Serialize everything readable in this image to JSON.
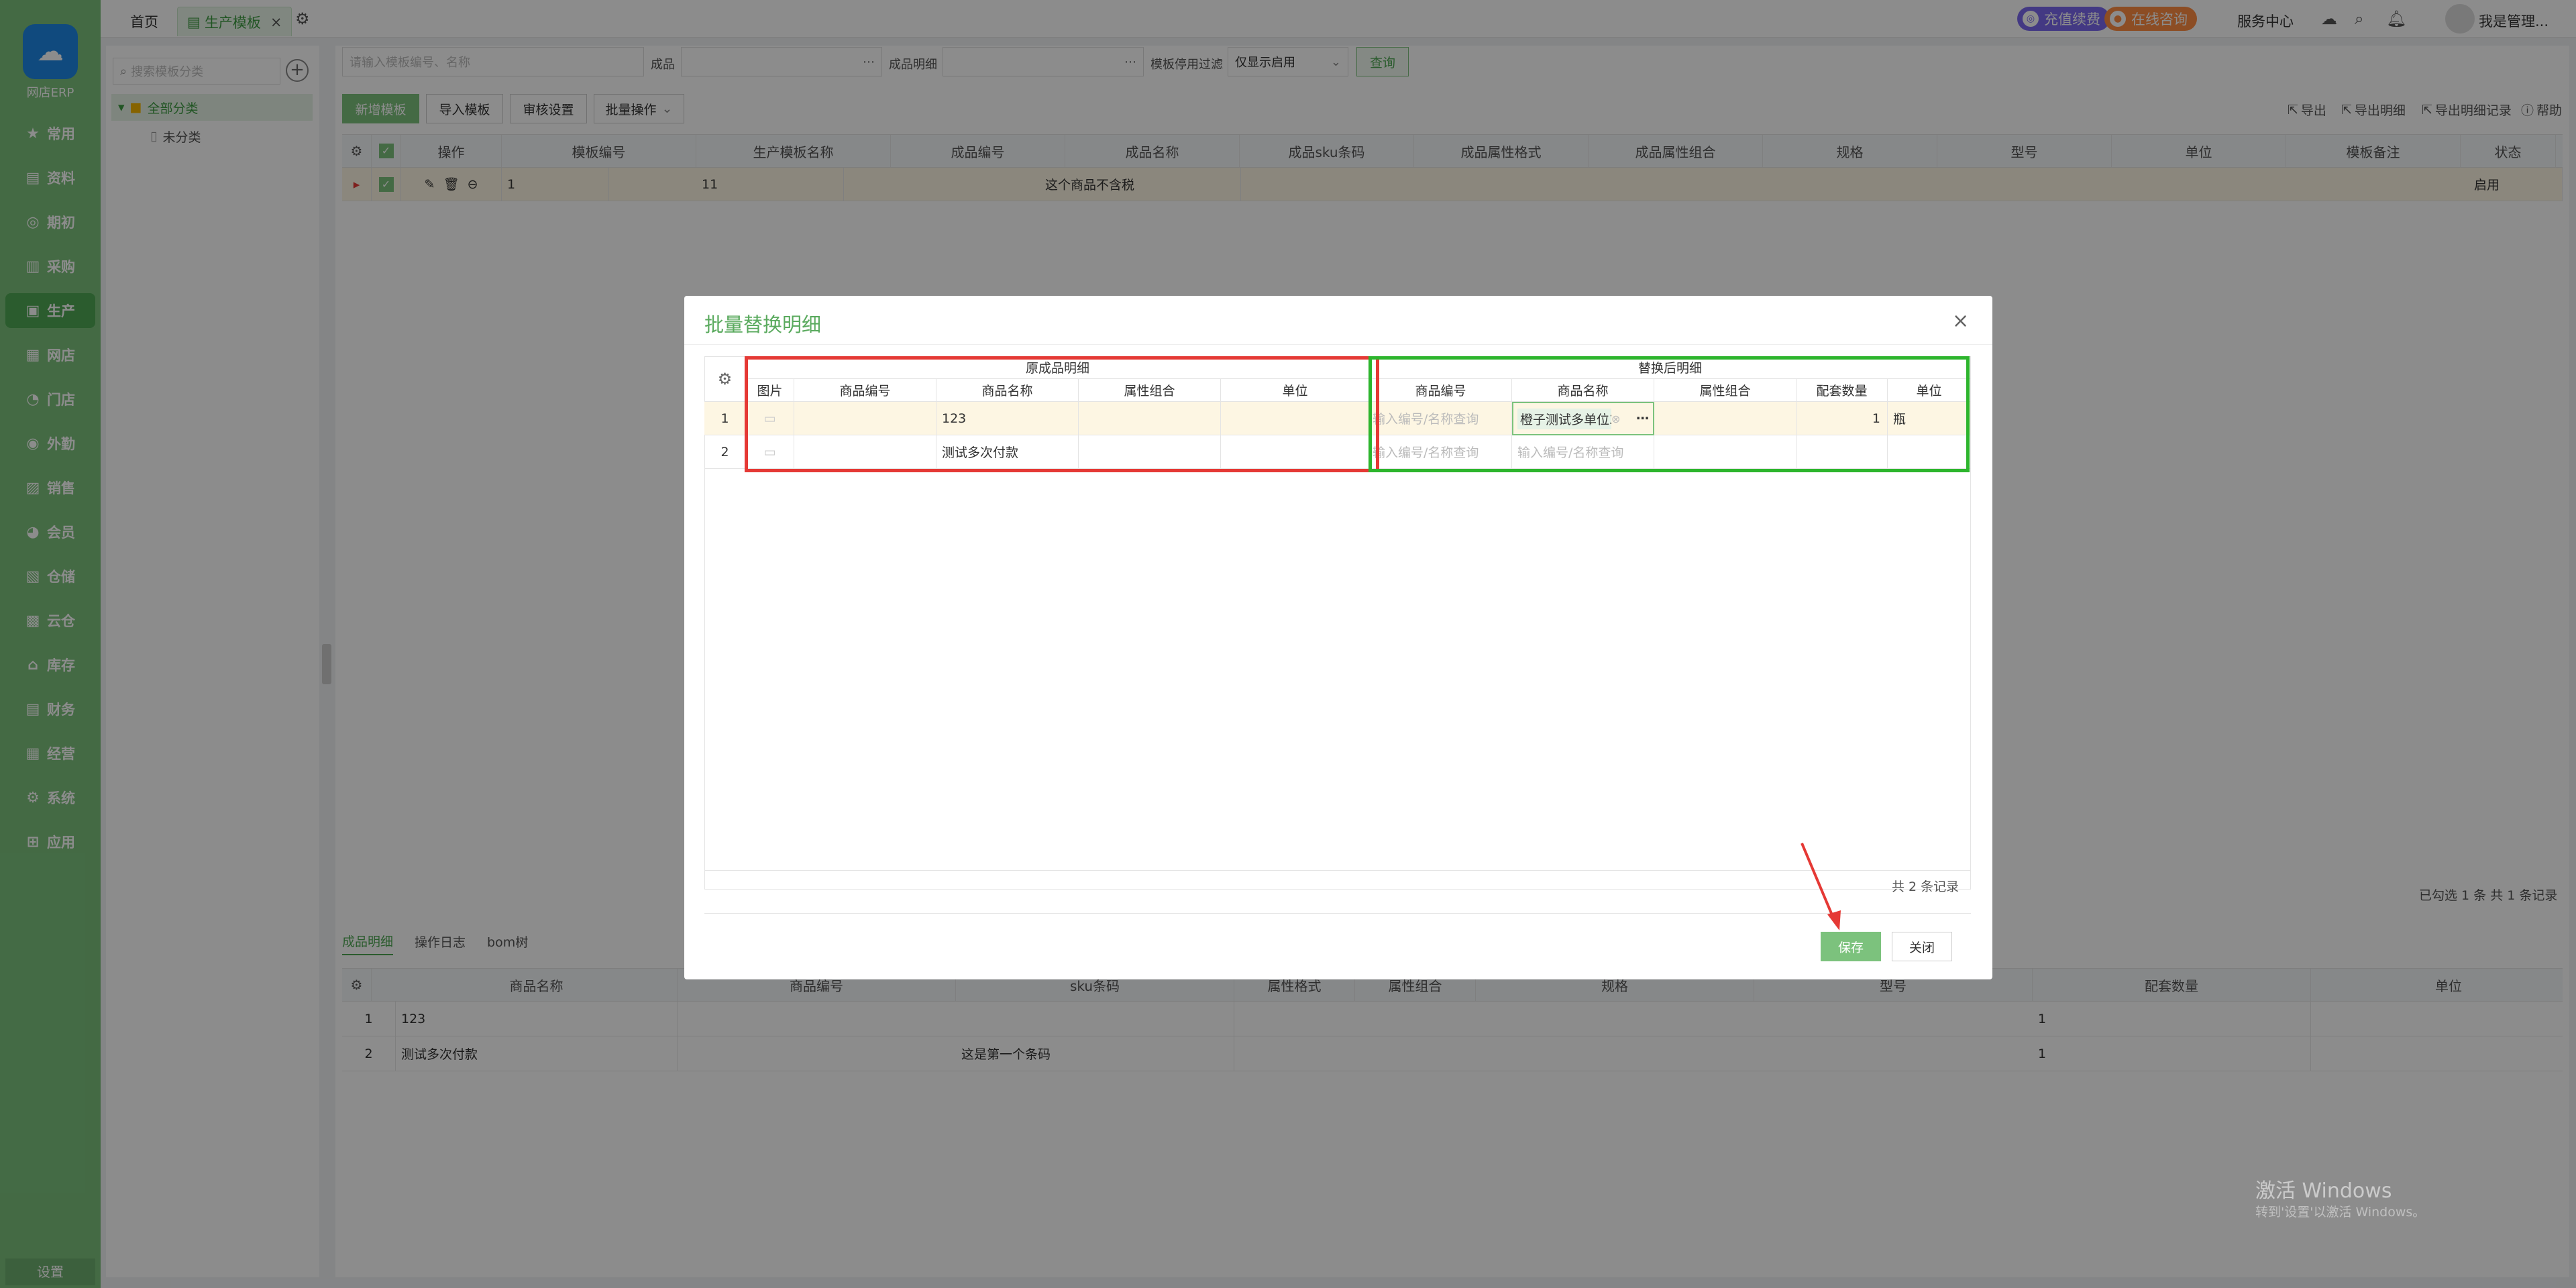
{
  "app": {
    "logo_text": "网店ERP"
  },
  "sidebar": {
    "items": [
      {
        "label": "常用",
        "icon": "star-icon"
      },
      {
        "label": "资料",
        "icon": "document-icon"
      },
      {
        "label": "期初",
        "icon": "target-icon"
      },
      {
        "label": "采购",
        "icon": "cart-icon"
      },
      {
        "label": "生产",
        "icon": "factory-icon"
      },
      {
        "label": "网店",
        "icon": "store-icon"
      },
      {
        "label": "门店",
        "icon": "pie-icon"
      },
      {
        "label": "外勤",
        "icon": "field-icon"
      },
      {
        "label": "销售",
        "icon": "sales-icon"
      },
      {
        "label": "会员",
        "icon": "member-icon"
      },
      {
        "label": "仓储",
        "icon": "warehouse-icon"
      },
      {
        "label": "云仓",
        "icon": "cloud-warehouse-icon"
      },
      {
        "label": "库存",
        "icon": "inventory-icon"
      },
      {
        "label": "财务",
        "icon": "finance-icon"
      },
      {
        "label": "经营",
        "icon": "business-icon"
      },
      {
        "label": "系统",
        "icon": "system-icon"
      },
      {
        "label": "应用",
        "icon": "app-icon"
      }
    ],
    "settings_label": "设置",
    "active_color": "#4fa854"
  },
  "topbar": {
    "tabs": [
      {
        "label": "首页"
      },
      {
        "label": "生产模板"
      }
    ],
    "recharge_label": "充值续费",
    "consult_label": "在线咨询",
    "service_label": "服务中心",
    "user_label": "我是管理..."
  },
  "tree": {
    "search_placeholder": "搜索模板分类",
    "root_label": "全部分类",
    "child_label": "未分类"
  },
  "filters": {
    "search_placeholder": "请输入模板编号、名称",
    "product_label": "成品",
    "product_detail_label": "成品明细",
    "disable_filter_label": "模板停用过滤",
    "disable_filter_value": "仅显示启用",
    "query_label": "查询"
  },
  "toolbar": {
    "new_label": "新增模板",
    "import_label": "导入模板",
    "audit_label": "审核设置",
    "batch_label": "批量操作",
    "export_label": "导出",
    "export_detail_label": "导出明细",
    "export_record_label": "导出明细记录",
    "help_label": "帮助"
  },
  "grid": {
    "columns": [
      "操作",
      "模板编号",
      "生产模板名称",
      "成品编号",
      "成品名称",
      "成品sku条码",
      "成品属性格式",
      "成品属性组合",
      "规格",
      "型号",
      "单位",
      "模板备注",
      "状态"
    ],
    "row": {
      "num": "1",
      "code": "11",
      "name": "这个商品不含税",
      "status": "启用"
    },
    "footer": "已勾选 1 条  共 1 条记录"
  },
  "bottom": {
    "tabs": [
      "成品明细",
      "操作日志",
      "bom树"
    ],
    "columns": [
      "商品名称",
      "商品编号",
      "sku条码",
      "属性格式",
      "属性组合",
      "规格",
      "型号",
      "配套数量",
      "单位"
    ],
    "rows": [
      {
        "num": "1",
        "name": "123",
        "sku": "",
        "qty": "1"
      },
      {
        "num": "2",
        "name": "测试多次付款",
        "sku": "这是第一个条码",
        "qty": "1"
      }
    ]
  },
  "dialog": {
    "title": "批量替换明细",
    "original_group": "原成品明细",
    "replace_group": "替换后明细",
    "original_columns": [
      "图片",
      "商品编号",
      "商品名称",
      "属性组合",
      "单位"
    ],
    "replace_columns": [
      "商品编号",
      "商品名称",
      "属性组合",
      "配套数量",
      "单位"
    ],
    "code_placeholder": "输入编号/名称查询",
    "name_placeholder": "输入编号/名称查询",
    "rows": [
      {
        "num": "1",
        "name": "123",
        "replace_name": "橙子测试多单位3",
        "qty": "1",
        "unit": "瓶"
      },
      {
        "num": "2",
        "name": "测试多次付款",
        "replace_name": "",
        "qty": "",
        "unit": ""
      }
    ],
    "total": "共 2 条记录",
    "save_label": "保存",
    "close_label": "关闭"
  },
  "watermark": {
    "line1": "激活 Windows",
    "line2": "转到'设置'以激活 Windows。"
  }
}
